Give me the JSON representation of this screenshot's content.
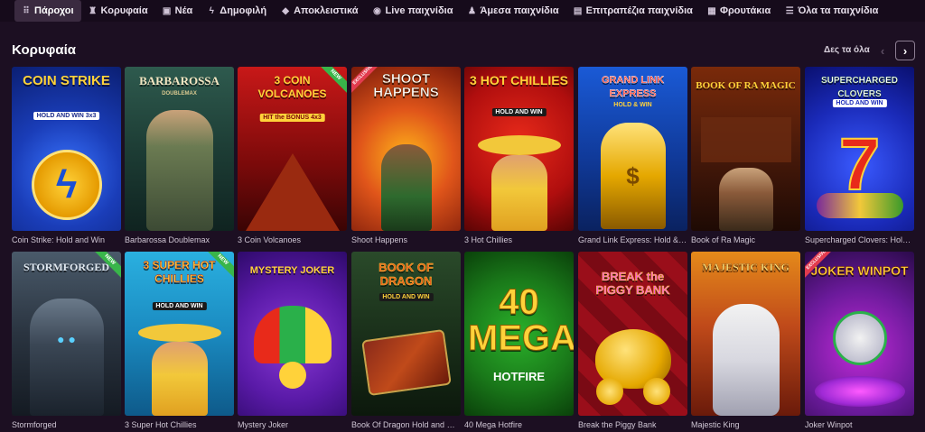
{
  "nav": {
    "items": [
      {
        "icon": "grid-icon",
        "glyph": "⠿",
        "label": "Πάροχοι"
      },
      {
        "icon": "trophy-icon",
        "glyph": "♜",
        "label": "Κορυφαία"
      },
      {
        "icon": "new-icon",
        "glyph": "▣",
        "label": "Νέα"
      },
      {
        "icon": "flash-icon",
        "glyph": "ϟ",
        "label": "Δημοφιλή"
      },
      {
        "icon": "diamond-icon",
        "glyph": "◆",
        "label": "Αποκλειστικά"
      },
      {
        "icon": "live-icon",
        "glyph": "◉",
        "label": "Live παιχνίδια"
      },
      {
        "icon": "person-icon",
        "glyph": "♟",
        "label": "Άμεσα παιχνίδια"
      },
      {
        "icon": "cards-icon",
        "glyph": "▤",
        "label": "Επιτραπέζια παιχνίδια"
      },
      {
        "icon": "slot-icon",
        "glyph": "▦",
        "label": "Φρουτάκια"
      },
      {
        "icon": "list-icon",
        "glyph": "☰",
        "label": "Όλα τα παιχνίδια"
      }
    ]
  },
  "section": {
    "title": "Κορυφαία",
    "see_all": "Δες τα όλα",
    "prev_glyph": "‹",
    "next_glyph": "›"
  },
  "badges": {
    "new": "NEW",
    "exclusive": "EXCLUSIVE"
  },
  "games": [
    {
      "name": "Coin Strike: Hold and Win",
      "art_title": "COIN STRIKE",
      "art_sub": "HOLD AND WIN 3x3"
    },
    {
      "name": "Barbarossa Doublemax",
      "art_title": "BARBAROSSA",
      "art_sub": "DOUBLEMAX"
    },
    {
      "name": "3 Coin Volcanoes",
      "art_title": "3 COIN VOLCANOES",
      "art_sub": "HIT the BONUS 4x3"
    },
    {
      "name": "Shoot Happens",
      "art_title": "SHOOT HAPPENS",
      "art_sub": ""
    },
    {
      "name": "3 Hot Chillies",
      "art_title": "3 HOT CHILLIES",
      "art_sub": "HOLD AND WIN"
    },
    {
      "name": "Grand Link Express: Hold & Win",
      "art_title": "GRAND LINK EXPRESS",
      "art_sub": "HOLD & WIN"
    },
    {
      "name": "Book of Ra Magic",
      "art_title": "BOOK OF RA MAGIC",
      "art_sub": ""
    },
    {
      "name": "Supercharged Clovers: Hold and Win",
      "art_title": "SUPERCHARGED CLOVERS",
      "art_sub": "HOLD AND WIN"
    },
    {
      "name": "Stormforged",
      "art_title": "STORMFORGED",
      "art_sub": ""
    },
    {
      "name": "3 Super Hot Chillies",
      "art_title": "3 SUPER HOT CHILLIES",
      "art_sub": "HOLD AND WIN"
    },
    {
      "name": "Mystery Joker",
      "art_title": "MYSTERY JOKER",
      "art_sub": ""
    },
    {
      "name": "Book Of Dragon Hold and Win",
      "art_title": "BOOK OF DRAGON",
      "art_sub": "HOLD AND WIN"
    },
    {
      "name": "40 Mega Hotfire",
      "art_title": "40 MEGA",
      "art_sub": "HOTFIRE"
    },
    {
      "name": "Break the Piggy Bank",
      "art_title": "BREAK the PIGGY BANK",
      "art_sub": ""
    },
    {
      "name": "Majestic King",
      "art_title": "MAJESTIC KING",
      "art_sub": ""
    },
    {
      "name": "Joker Winpot",
      "art_title": "JOKER WINPOT",
      "art_sub": ""
    }
  ],
  "colors": {
    "background": "#1c0f22",
    "nav_background": "#160b1b",
    "active_tab": "#3a2a40",
    "new_badge": "#39b54a",
    "exclusive_badge": "#e23b4e"
  }
}
